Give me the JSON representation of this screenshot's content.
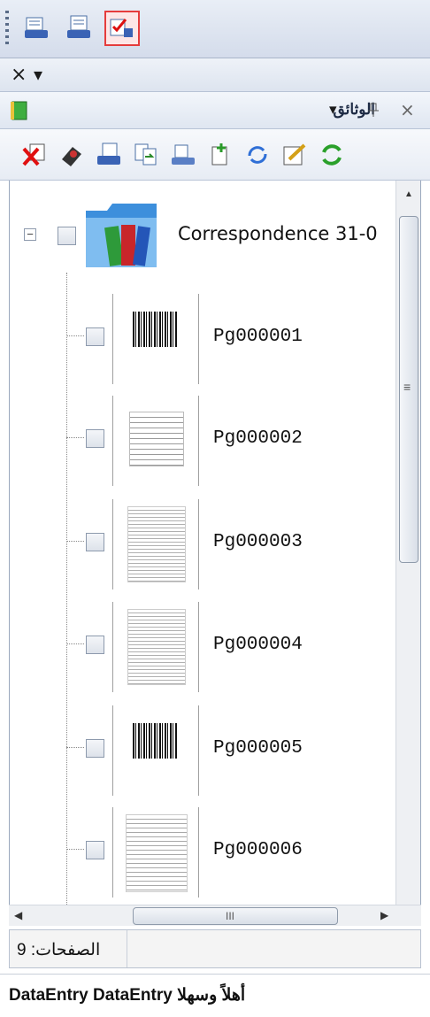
{
  "toolbar": {
    "buttons": [
      {
        "icon": "scanner-icon",
        "selected": false
      },
      {
        "icon": "batch-scan-icon",
        "selected": false
      },
      {
        "icon": "quality-check-icon",
        "selected": true
      }
    ]
  },
  "dock": {
    "close_glyph": "×",
    "menu_glyph": "▾"
  },
  "panel": {
    "title": "الوثائق",
    "pin_glyph": "📌",
    "close_glyph": "×",
    "dropdown_glyph": "▾"
  },
  "actions": [
    "delete-icon",
    "scan-icon",
    "import-icon",
    "move-pages-icon",
    "rescan-icon",
    "insert-page-icon",
    "rotate-icon",
    "edit-icon",
    "refresh-icon"
  ],
  "tree": {
    "root": {
      "label": "Correspondence 31-0",
      "expand_glyph": "−"
    },
    "pages": [
      {
        "label": "Pg000001",
        "thumb": "barcode"
      },
      {
        "label": "Pg000002",
        "thumb": "form"
      },
      {
        "label": "Pg000003",
        "thumb": "table"
      },
      {
        "label": "Pg000004",
        "thumb": "table"
      },
      {
        "label": "Pg000005",
        "thumb": "barcode"
      },
      {
        "label": "Pg000006",
        "thumb": "letter"
      }
    ]
  },
  "scroll": {
    "h_thumb_glyph": "III",
    "v_thumb_glyph": "≡"
  },
  "status": {
    "page_count_text": "الصفحات: 9"
  },
  "user": {
    "text": "DataEntry DataEntry أهلاً وسهلا"
  },
  "colors": {
    "selected_border": "#e53c3c",
    "folder_blue": "#3d8fdc"
  }
}
